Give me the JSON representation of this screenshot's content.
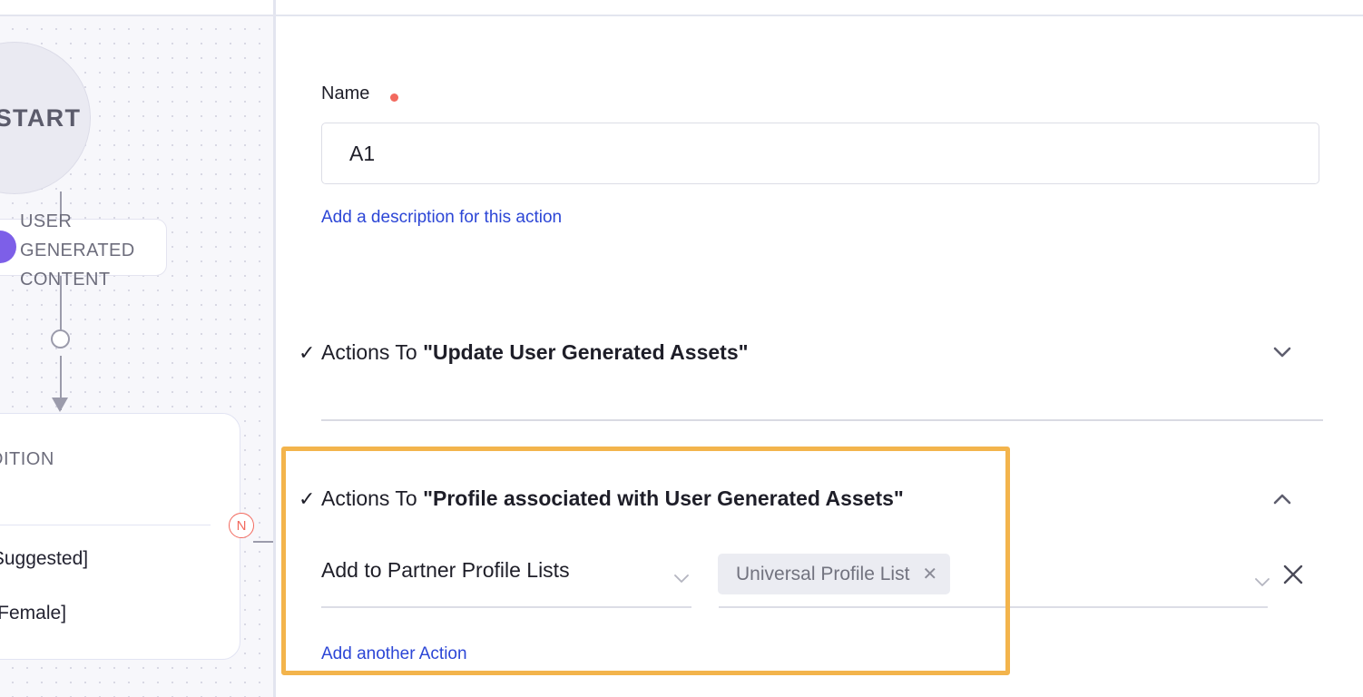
{
  "canvas": {
    "start_node_label": "START",
    "ugc_node_label": "USER\nGENERATED\nCONTENT",
    "condition_node_title": "DITION",
    "condition_line_1": "[Suggested]",
    "condition_line_2": "s [Female]",
    "branch_badge_label": "N",
    "colors": {
      "start_fill": "#eaeaf2",
      "badge_purple": "#7d5fe8",
      "branch_red": "#f2695e",
      "edge_gray": "#9b9bab"
    }
  },
  "panel": {
    "name_field": {
      "label": "Name",
      "required": true,
      "value": "A1",
      "placeholder": "Name"
    },
    "description_link": "Add a description for this action",
    "sections": [
      {
        "check_glyph": "✓",
        "prefix": "Actions To ",
        "quoted_title": "\"Update User Generated Assets\"",
        "expanded": false,
        "toggle_icon": "chevron-down-icon"
      },
      {
        "check_glyph": "✓",
        "prefix": "Actions To ",
        "quoted_title": "\"Profile associated with User Generated Assets\"",
        "expanded": true,
        "toggle_icon": "chevron-up-icon",
        "highlighted": true,
        "action_row": {
          "select_value": "Add to Partner Profile Lists",
          "select_icon": "chevron-down-icon",
          "value_chip": {
            "label": "Universal Profile List",
            "remove_icon": "close-icon"
          },
          "value_select_icon": "chevron-down-icon",
          "remove_row_icon": "close-icon"
        },
        "add_another_link": "Add another Action"
      }
    ],
    "colors": {
      "link_blue": "#2c46d6",
      "required_dot": "#f2695e",
      "highlight_orange": "#f3b44c",
      "chip_bg": "#ebecf2"
    }
  }
}
